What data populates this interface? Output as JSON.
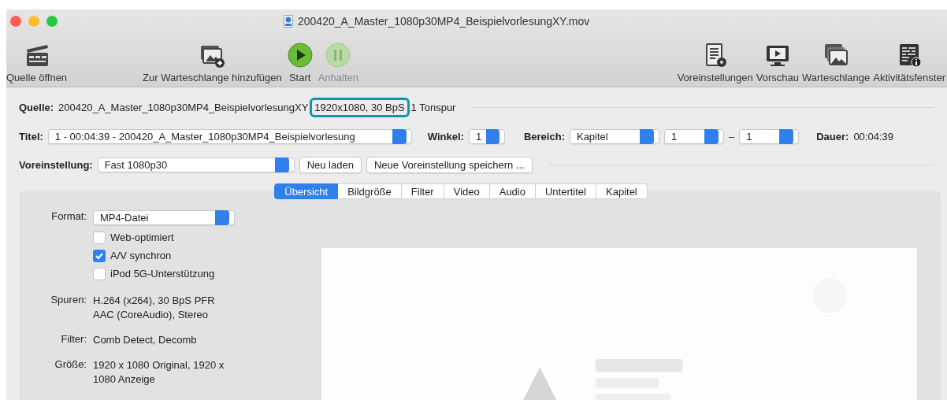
{
  "window": {
    "title": "200420_A_Master_1080p30MP4_BeispielvorlesungXY.mov"
  },
  "toolbar": {
    "left_items": [
      {
        "kind": "open",
        "label": "Quelle öffnen",
        "disabled": false
      }
    ],
    "center_items": [
      {
        "kind": "add",
        "label": "Zur Warteschlange hinzufügen",
        "disabled": false
      },
      {
        "kind": "start",
        "label": "Start",
        "disabled": false
      },
      {
        "kind": "pause",
        "label": "Anhalten",
        "disabled": true
      }
    ],
    "right_items": [
      {
        "kind": "presets",
        "label": "Voreinstellungen",
        "disabled": false
      },
      {
        "kind": "preview",
        "label": "Vorschau",
        "disabled": false
      },
      {
        "kind": "queue",
        "label": "Warteschlange",
        "disabled": false
      },
      {
        "kind": "activity",
        "label": "Aktivitätsfenster",
        "disabled": false
      }
    ]
  },
  "source": {
    "label": "Quelle:",
    "file": "200420_A_Master_1080p30MP4_BeispielvorlesungXY",
    "highlight": "1920x1080, 30 BpS",
    "rest": "1 Tonspur"
  },
  "title_row": {
    "label": "Titel:",
    "title": "1 - 00:04:39 - 200420_A_Master_1080p30MP4_Beispielvorlesung",
    "angle_label": "Winkel:",
    "angle": "1",
    "range_label": "Bereich:",
    "range": "Kapitel",
    "from": "1",
    "dash": "–",
    "to": "1",
    "duration_label": "Dauer:",
    "duration": "00:04:39"
  },
  "preset_row": {
    "label": "Voreinstellung:",
    "preset": "Fast 1080p30",
    "buttons": [
      "Neu laden",
      "Neue Voreinstellung speichern ..."
    ]
  },
  "tabs": [
    {
      "label": "Übersicht",
      "selected": true
    },
    {
      "label": "Bildgröße",
      "selected": false
    },
    {
      "label": "Filter",
      "selected": false
    },
    {
      "label": "Video",
      "selected": false
    },
    {
      "label": "Audio",
      "selected": false
    },
    {
      "label": "Untertitel",
      "selected": false
    },
    {
      "label": "Kapitel",
      "selected": false
    }
  ],
  "summary": {
    "format_label": "Format:",
    "format": "MP4-Datei",
    "options": [
      {
        "label": "Web-optimiert",
        "checked": false
      },
      {
        "label": "A/V synchron",
        "checked": true
      },
      {
        "label": "iPod 5G-Unterstützung",
        "checked": false
      }
    ],
    "info": [
      {
        "label": "Spuren:",
        "lines": [
          "H.264 (x264), 30 BpS PFR",
          "AAC (CoreAudio), Stereo"
        ]
      },
      {
        "label": "Filter:",
        "lines": [
          "Comb Detect, Decomb"
        ]
      },
      {
        "label": "Größe:",
        "lines": [
          "1920 x 1080 Original, 1920 x",
          "1080 Anzeige"
        ]
      }
    ]
  }
}
